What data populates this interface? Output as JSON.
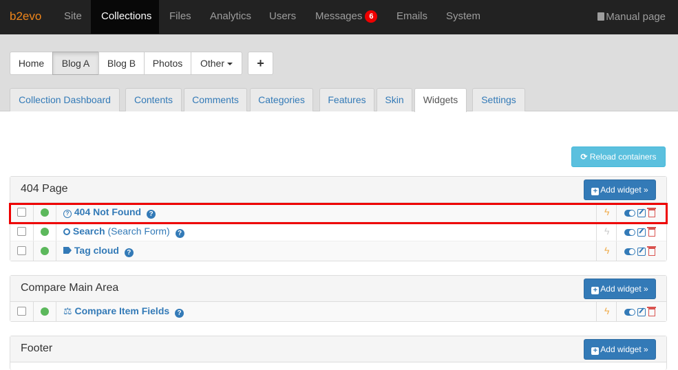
{
  "navbar": {
    "brand": "b2evo",
    "items": [
      "Site",
      "Collections",
      "Files",
      "Analytics",
      "Users",
      "Messages",
      "Emails",
      "System"
    ],
    "messages_count": "6",
    "manual": "Manual page"
  },
  "collections": [
    "Home",
    "Blog A",
    "Blog B",
    "Photos",
    "Other"
  ],
  "add_collection": "+",
  "tabs": [
    "Collection Dashboard",
    "Contents",
    "Comments",
    "Categories",
    "Features",
    "Skin",
    "Widgets",
    "Settings"
  ],
  "reload_label": "Reload containers",
  "add_widget_label": "Add widget »",
  "containers": [
    {
      "title": "404 Page",
      "widgets": [
        {
          "name": "404 Not Found",
          "sub": "",
          "icon": "question-circle-icon",
          "bolt_active": true
        },
        {
          "name": "Search",
          "sub": "(Search Form)",
          "icon": "search-icon",
          "bolt_active": false
        },
        {
          "name": "Tag cloud",
          "sub": "",
          "icon": "tags-icon",
          "bolt_active": true
        }
      ]
    },
    {
      "title": "Compare Main Area",
      "widgets": [
        {
          "name": "Compare Item Fields",
          "sub": "",
          "icon": "balance-scale-icon",
          "bolt_active": true
        }
      ]
    },
    {
      "title": "Footer",
      "widgets": []
    }
  ],
  "colors": {
    "brand": "#f0861a",
    "primary": "#337ab7",
    "info": "#5bc0de",
    "status_on": "#5cb85c",
    "highlight": "#e00000"
  }
}
